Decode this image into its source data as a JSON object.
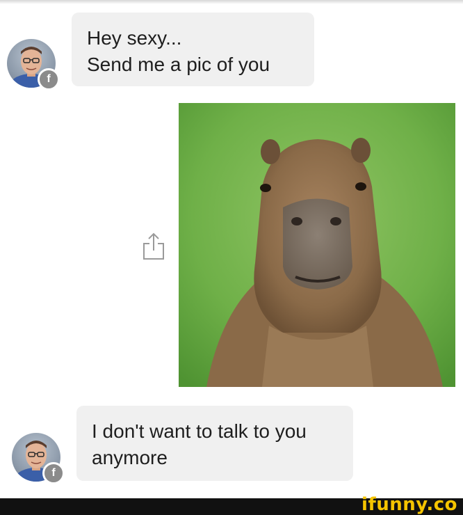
{
  "messages": [
    {
      "sender": "contact",
      "lines": [
        "Hey sexy...",
        "Send me a pic of you"
      ]
    },
    {
      "sender": "contact",
      "lines": [
        "I don't want to talk to you",
        "anymore"
      ]
    }
  ],
  "badge": {
    "glyph": "f",
    "icon": "facebook-badge-icon"
  },
  "attachment": {
    "type": "photo",
    "subject": "capybara",
    "share_icon": "share-icon"
  },
  "watermark": {
    "text": "ifunny.co"
  },
  "colors": {
    "bubble": "#f0f0f0",
    "text": "#1e1e1e",
    "badge": "#8b8b8b",
    "watermark": "#f5c400",
    "bar": "#111111"
  }
}
